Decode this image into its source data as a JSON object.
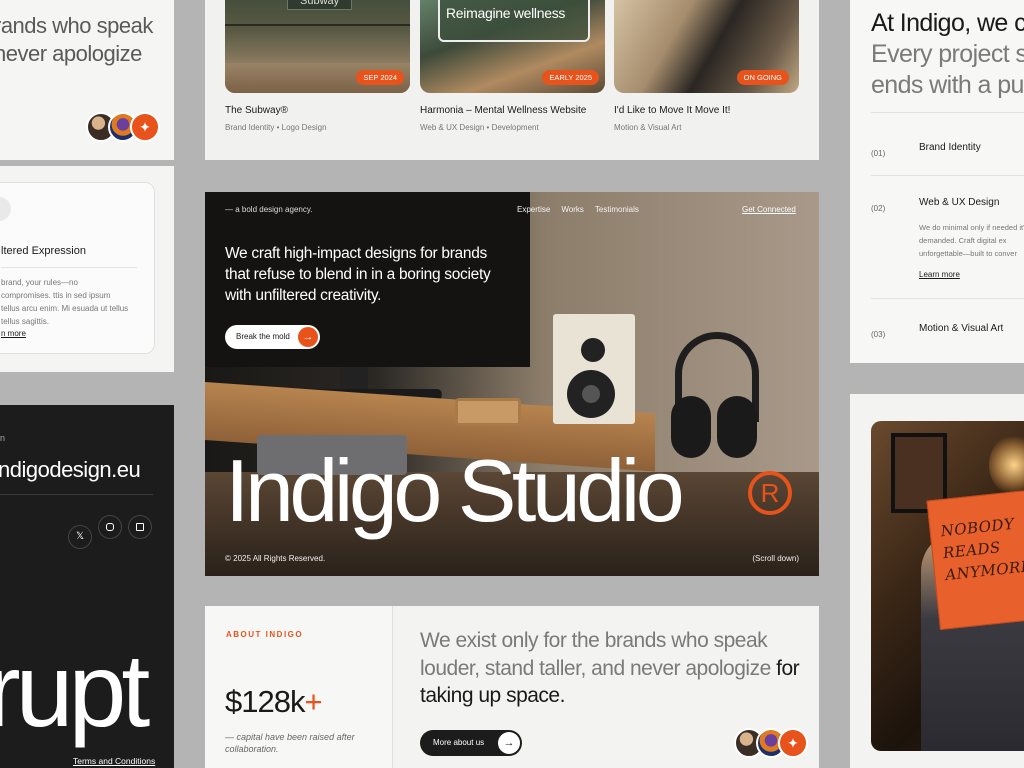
{
  "left_top": {
    "line1": "rands who speak",
    "line2": "never apologize"
  },
  "left_service": {
    "title": "ltered Expression",
    "body": "brand, your rules—no compromises. ttis in sed ipsum tellus arcu enim. Mi esuada ut tellus tellus sagittis.",
    "link": "n more"
  },
  "left_footer": {
    "label": "n",
    "email": "ndigodesign.eu",
    "big_word": "rupt",
    "terms": "Terms and Conditions"
  },
  "works": [
    {
      "title": "The Subway®",
      "tags": [
        "Brand Identity",
        "Logo Design"
      ],
      "badge": "SEP 2024",
      "photo_text": "Subway"
    },
    {
      "title": "Harmonia – Mental Wellness Website",
      "tags": [
        "Web & UX Design",
        "Development"
      ],
      "badge": "EARLY 2025",
      "photo_text": "Reimagine wellness"
    },
    {
      "title": "I'd Like to Move It Move It!",
      "tags": [
        "Motion & Visual Art"
      ],
      "badge": "ON GOING"
    }
  ],
  "hero": {
    "tagline": "— a bold design agency.",
    "nav": [
      "Expertise",
      "Works",
      "Testimonials"
    ],
    "cta_nav": "Get Connected",
    "headline": "We craft high-impact designs for brands that refuse to blend in in a boring society with unfiltered creativity.",
    "button": "Break the mold",
    "brand": "Indigo Studio",
    "registered": "R",
    "copyright": "© 2025 All Rights Reserved.",
    "scroll": "(Scroll down)"
  },
  "about": {
    "label": "ABOUT INDIGO",
    "stat": "$128k",
    "stat_plus": "+",
    "stat_caption": "— capital have been raised after collaboration.",
    "statement_muted": "We exist only for the brands who speak louder, stand taller, and never apologize",
    "statement_dark": "for taking up space.",
    "button": "More about us"
  },
  "right_services": {
    "heading_dark": "At Indigo, we c",
    "heading_muted_1": "Every project s",
    "heading_muted_2": "ends with a pu",
    "items": [
      {
        "num": "(01)",
        "name": "Brand Identity"
      },
      {
        "num": "(02)",
        "name": "Web & UX Design",
        "body": "We do minimal only if needed it's demanded. Craft digital ex unforgettable—built to conver",
        "link": "Learn more"
      },
      {
        "num": "(03)",
        "name": "Motion & Visual Art"
      }
    ]
  },
  "right_photo": {
    "book_text": "NOBODY READS ANYMORE."
  },
  "colors": {
    "accent": "#e8531c",
    "dark": "#1c1c1c",
    "bg": "#b4b4b4"
  }
}
